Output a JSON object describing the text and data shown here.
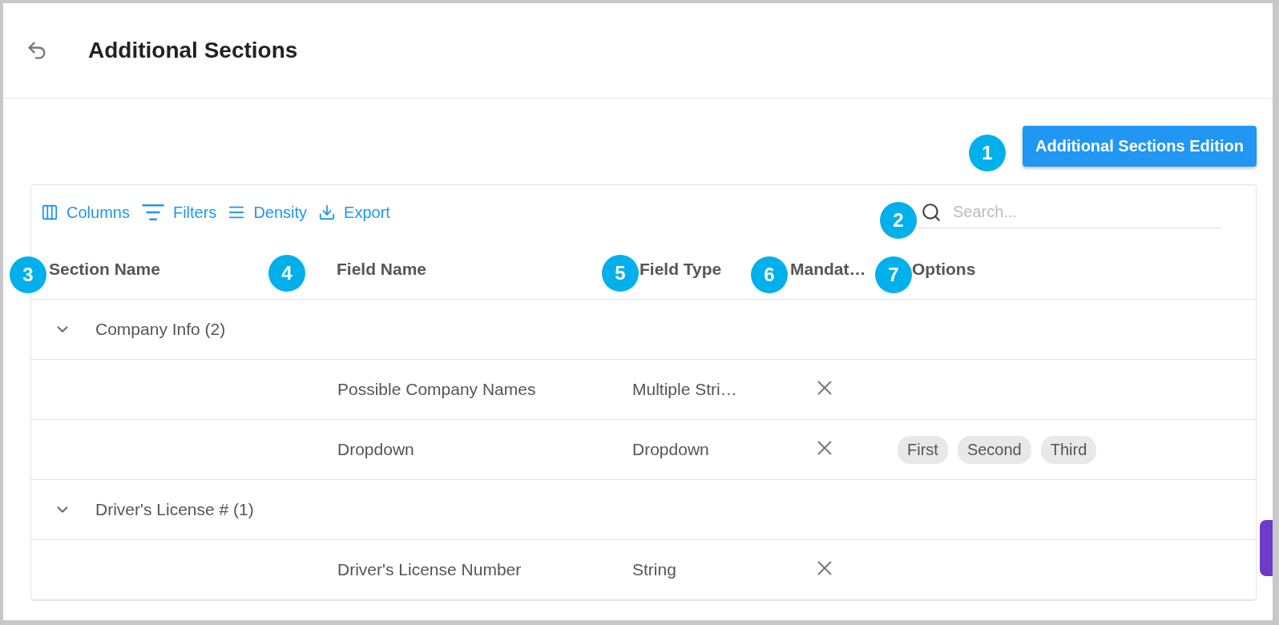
{
  "header": {
    "title": "Additional Sections"
  },
  "edit_button": {
    "label": "Additional Sections Edition"
  },
  "toolbar": {
    "buttons": [
      {
        "kind": "columns",
        "label": "Columns"
      },
      {
        "kind": "filters",
        "label": "Filters"
      },
      {
        "kind": "density",
        "label": "Density"
      },
      {
        "kind": "export",
        "label": "Export"
      }
    ],
    "search": {
      "placeholder": "Search..."
    }
  },
  "table": {
    "columns": [
      "Section Name",
      "Field Name",
      "Field Type",
      "Mandat…",
      "Options"
    ],
    "rows": [
      {
        "kind": "group",
        "label": "Company Info (2)",
        "expanded": true
      },
      {
        "kind": "field",
        "field_name": "Possible Company Names",
        "field_type": "Multiple Stri…",
        "mandatory": false,
        "options": []
      },
      {
        "kind": "field",
        "field_name": "Dropdown",
        "field_type": "Dropdown",
        "mandatory": false,
        "options": [
          "First",
          "Second",
          "Third"
        ]
      },
      {
        "kind": "group",
        "label": "Driver's License # (1)",
        "expanded": true
      },
      {
        "kind": "field",
        "field_name": "Driver's License Number",
        "field_type": "String",
        "mandatory": false,
        "options": []
      }
    ]
  },
  "callouts": [
    "1",
    "2",
    "3",
    "4",
    "5",
    "6",
    "7"
  ]
}
